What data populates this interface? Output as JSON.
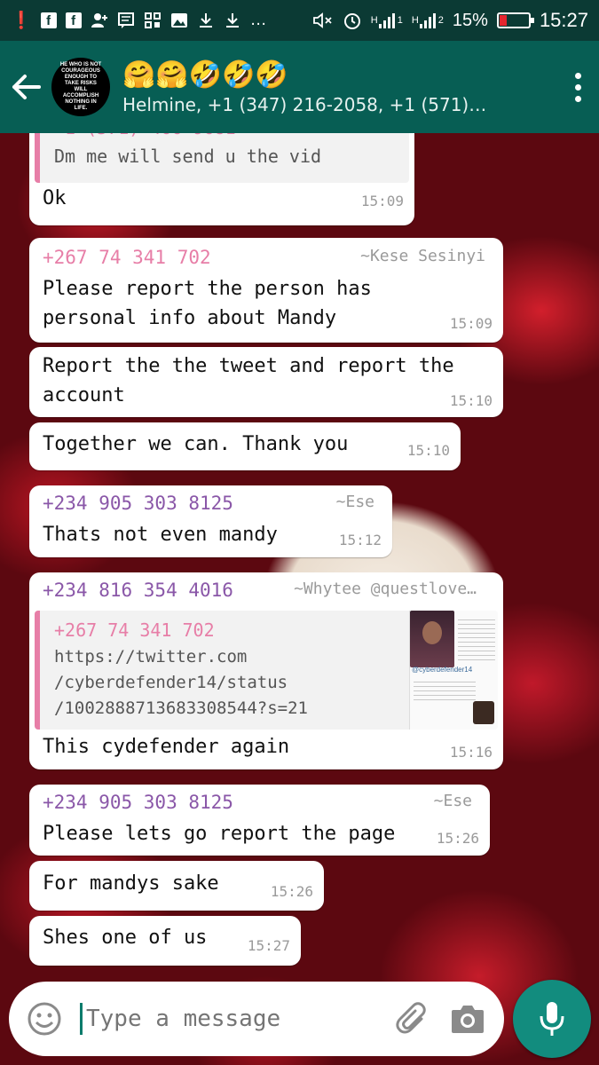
{
  "status_bar": {
    "carrier_h1": "H",
    "carrier_h2": "H",
    "sim1": "1",
    "sim2": "2",
    "battery": "15%",
    "time": "15:27",
    "more": "…"
  },
  "header": {
    "title_emoji": "🤗🤗🤣🤣🤣",
    "subtitle": "Helmine, +1 (347) 216-2058, +1 (571)…",
    "avatar_text": "HE WHO IS NOT COURAGEOUS ENOUGH TO TAKE RISKS WILL ACCOMPLISH NOTHING IN LIFE."
  },
  "messages": [
    {
      "quote_text": "Dm me will send u the vid",
      "text": "Ok",
      "time": "15:09"
    },
    {
      "sender": "+267 74 341 702",
      "alias": "~Kese Sesinyi",
      "text": "Please report the person has\npersonal info about Mandy",
      "time": "15:09"
    },
    {
      "text": "Report the the tweet and report the\naccount",
      "time": "15:10"
    },
    {
      "text": "Together we can. Thank you",
      "time": "15:10"
    },
    {
      "sender": "+234 905 303 8125",
      "alias": "~Ese",
      "text": "Thats not even mandy",
      "time": "15:12"
    },
    {
      "sender": "+234 816 354 4016",
      "alias": "~Whytee @questlove…",
      "quote_sender": "+267 74 341 702",
      "quote_text": "https://twitter.com\n/cyberdefender14/status\n/1002888713683308544?s=21",
      "thumb_caption": "@cyberdefender14",
      "text": "This cydefender again",
      "time": "15:16"
    },
    {
      "sender": "+234 905 303 8125",
      "alias": "~Ese",
      "text": "Please lets go report the page",
      "time": "15:26"
    },
    {
      "text": "For mandys sake",
      "time": "15:26"
    },
    {
      "text": "Shes one of us",
      "time": "15:27"
    }
  ],
  "composer": {
    "placeholder": "Type a message"
  },
  "colors": {
    "status_bar": "#0b3a34",
    "header": "#075e54",
    "accent": "#128c7e",
    "sender_pink": "#e77ea7",
    "sender_purple": "#8a57a8"
  }
}
